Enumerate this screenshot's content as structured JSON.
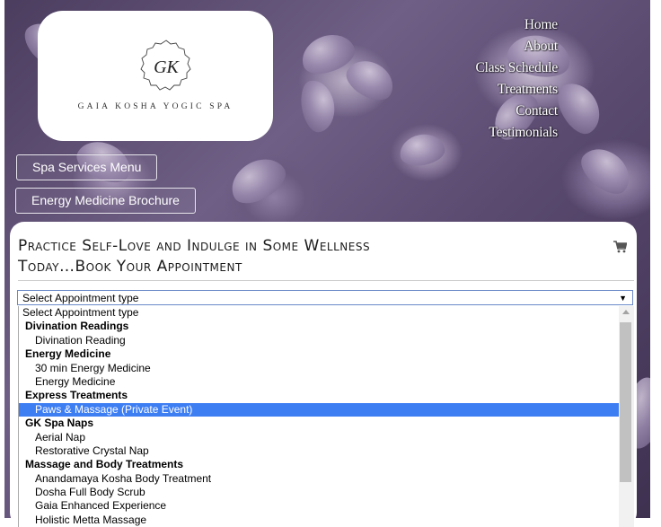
{
  "brand": {
    "monogram": "GK",
    "name": "GAIA KOSHA YOGIC SPA"
  },
  "nav": {
    "items": [
      "Home",
      "About",
      "Class Schedule",
      "Treatments",
      "Contact",
      "Testimonials"
    ]
  },
  "buttons": {
    "spa_menu": "Spa Services Menu",
    "energy_brochure": "Energy Medicine Brochure"
  },
  "booking": {
    "headline_line1": "Practice Self-Love and Indulge in Some Wellness",
    "headline_line2": "Today…Book Your Appointment",
    "cart_icon": "shopping-cart-icon",
    "select": {
      "value": "Select Appointment type",
      "arrow": "▼"
    },
    "options": [
      {
        "label": "Select Appointment type",
        "kind": "option"
      },
      {
        "label": "Divination Readings",
        "kind": "group"
      },
      {
        "label": "Divination Reading",
        "kind": "sub"
      },
      {
        "label": "Energy Medicine",
        "kind": "group"
      },
      {
        "label": "30 min Energy Medicine",
        "kind": "sub"
      },
      {
        "label": "Energy Medicine",
        "kind": "sub"
      },
      {
        "label": "Express Treatments",
        "kind": "group"
      },
      {
        "label": "Paws & Massage (Private Event)",
        "kind": "sub",
        "selected": true
      },
      {
        "label": "GK Spa Naps",
        "kind": "group"
      },
      {
        "label": "Aerial Nap",
        "kind": "sub"
      },
      {
        "label": "Restorative Crystal Nap",
        "kind": "sub"
      },
      {
        "label": "Massage and Body Treatments",
        "kind": "group"
      },
      {
        "label": "Anandamaya Kosha Body Treatment",
        "kind": "sub"
      },
      {
        "label": "Dosha Full Body Scrub",
        "kind": "sub"
      },
      {
        "label": "Gaia Enhanced Experience",
        "kind": "sub"
      },
      {
        "label": "Holistic Metta Massage",
        "kind": "sub"
      }
    ]
  },
  "colors": {
    "accent": "#3e7ef3",
    "background_tone": "#6f5f86"
  }
}
